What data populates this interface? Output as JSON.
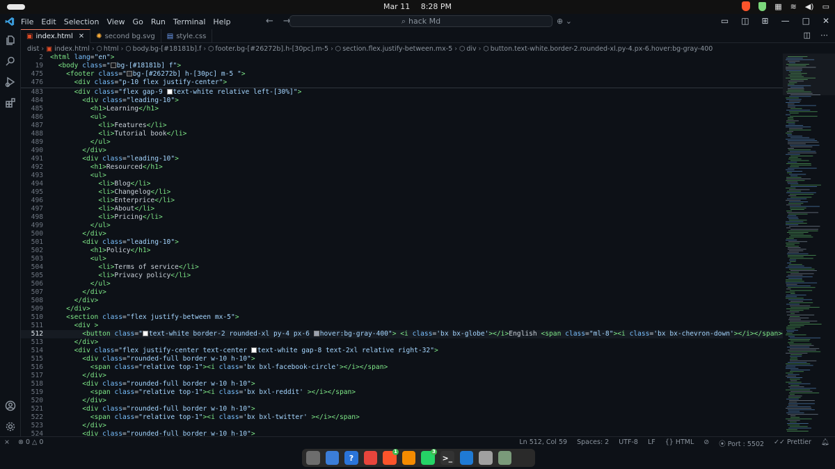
{
  "os": {
    "date": "Mar 11",
    "time": "8:28 PM",
    "volume_icon": "speaker-icon",
    "battery_icon": "battery-icon",
    "network_icon": "wifi-icon"
  },
  "titlebar": {
    "menu": [
      "File",
      "Edit",
      "Selection",
      "View",
      "Go",
      "Run",
      "Terminal",
      "Help"
    ],
    "search_text": "hack Md"
  },
  "tabs": [
    {
      "label": "index.html",
      "icon": "html-file-icon",
      "active": true,
      "color": "#e34c26"
    },
    {
      "label": "second bg.svg",
      "icon": "svg-file-icon",
      "active": false,
      "color": "#ffb13b"
    },
    {
      "label": "style.css",
      "icon": "css-file-icon",
      "active": false,
      "color": "#6e9ef5"
    }
  ],
  "breadcrumb": [
    "dist",
    "index.html",
    "html",
    "body.bg-[#18181b].f",
    "footer.bg-[#26272b].h-[30pc].m-5",
    "section.flex.justify-between.mx-5",
    "div",
    "button.text-white.border-2.rounded-xl.py-4.px-6.hover:bg-gray-400"
  ],
  "editor": {
    "lines": [
      {
        "n": "2",
        "html": "<span class='t-tag'>&lt;html</span> <span class='t-attr'>lang</span>=<span class='t-str'>\"en\"</span><span class='t-tag'>&gt;</span>"
      },
      {
        "n": "19",
        "html": "  <span class='t-tag'>&lt;body</span> <span class='t-attr'>class</span>=<span class='t-str'>\"<span class='sw' style='background:#18181b'></span>bg-[#18181b] f\"</span><span class='t-tag'>&gt;</span>"
      },
      {
        "n": "475",
        "html": "    <span class='t-tag'>&lt;footer</span> <span class='t-attr'>class</span>=<span class='t-str'>\"<span class='sw' style='background:#26272b'></span>bg-[#26272b] h-[30pc] m-5 \"</span><span class='t-tag'>&gt;</span>"
      },
      {
        "n": "476",
        "html": "      <span class='t-tag'>&lt;div</span> <span class='t-attr'>class</span>=<span class='t-str'>\"p-10 flex justify-center\"</span><span class='t-tag'>&gt;</span>"
      },
      {
        "n": "483",
        "html": "      <span class='t-tag'>&lt;div</span> <span class='t-attr'>class</span>=<span class='t-str'>\"flex gap-9 <span class='sw' style='background:#ffffff'></span>text-white relative left-[30%]\"</span><span class='t-tag'>&gt;</span>"
      },
      {
        "n": "484",
        "html": "        <span class='t-tag'>&lt;div</span> <span class='t-attr'>class</span>=<span class='t-str'>\"leading-10\"</span><span class='t-tag'>&gt;</span>"
      },
      {
        "n": "485",
        "html": "          <span class='t-tag'>&lt;h1&gt;</span>Learning<span class='t-tag'>&lt;/h1&gt;</span>"
      },
      {
        "n": "486",
        "html": "          <span class='t-tag'>&lt;ul&gt;</span>"
      },
      {
        "n": "487",
        "html": "            <span class='t-tag'>&lt;li&gt;</span>Features<span class='t-tag'>&lt;/li&gt;</span>"
      },
      {
        "n": "488",
        "html": "            <span class='t-tag'>&lt;li&gt;</span>Tutorial book<span class='t-tag'>&lt;/li&gt;</span>"
      },
      {
        "n": "489",
        "html": "          <span class='t-tag'>&lt;/ul&gt;</span>"
      },
      {
        "n": "490",
        "html": "        <span class='t-tag'>&lt;/div&gt;</span>"
      },
      {
        "n": "491",
        "html": "        <span class='t-tag'>&lt;div</span> <span class='t-attr'>class</span>=<span class='t-str'>\"leading-10\"</span><span class='t-tag'>&gt;</span>"
      },
      {
        "n": "492",
        "html": "          <span class='t-tag'>&lt;h1&gt;</span>Resourced<span class='t-tag'>&lt;/h1&gt;</span>"
      },
      {
        "n": "493",
        "html": "          <span class='t-tag'>&lt;ul&gt;</span>"
      },
      {
        "n": "494",
        "html": "            <span class='t-tag'>&lt;li&gt;</span>Blog<span class='t-tag'>&lt;/li&gt;</span>"
      },
      {
        "n": "495",
        "html": "            <span class='t-tag'>&lt;li&gt;</span>Changelog<span class='t-tag'>&lt;/li&gt;</span>"
      },
      {
        "n": "496",
        "html": "            <span class='t-tag'>&lt;li&gt;</span>Enterprice<span class='t-tag'>&lt;/li&gt;</span>"
      },
      {
        "n": "497",
        "html": "            <span class='t-tag'>&lt;li&gt;</span>About<span class='t-tag'>&lt;/li&gt;</span>"
      },
      {
        "n": "498",
        "html": "            <span class='t-tag'>&lt;li&gt;</span>Pricing<span class='t-tag'>&lt;/li&gt;</span>"
      },
      {
        "n": "499",
        "html": "          <span class='t-tag'>&lt;/ul&gt;</span>"
      },
      {
        "n": "500",
        "html": "        <span class='t-tag'>&lt;/div&gt;</span>"
      },
      {
        "n": "501",
        "html": "        <span class='t-tag'>&lt;div</span> <span class='t-attr'>class</span>=<span class='t-str'>\"leading-10\"</span><span class='t-tag'>&gt;</span>"
      },
      {
        "n": "502",
        "html": "          <span class='t-tag'>&lt;h1&gt;</span>Policy<span class='t-tag'>&lt;/h1&gt;</span>"
      },
      {
        "n": "503",
        "html": "          <span class='t-tag'>&lt;ul&gt;</span>"
      },
      {
        "n": "504",
        "html": "            <span class='t-tag'>&lt;li&gt;</span>Terms of service<span class='t-tag'>&lt;/li&gt;</span>"
      },
      {
        "n": "505",
        "html": "            <span class='t-tag'>&lt;li&gt;</span>Privacy policy<span class='t-tag'>&lt;/li&gt;</span>"
      },
      {
        "n": "506",
        "html": "          <span class='t-tag'>&lt;/ul&gt;</span>"
      },
      {
        "n": "507",
        "html": "        <span class='t-tag'>&lt;/div&gt;</span>"
      },
      {
        "n": "508",
        "html": "      <span class='t-tag'>&lt;/div&gt;</span>"
      },
      {
        "n": "509",
        "html": "    <span class='t-tag'>&lt;/div&gt;</span>"
      },
      {
        "n": "510",
        "html": "    <span class='t-tag'>&lt;section</span> <span class='t-attr'>class</span>=<span class='t-str'>\"flex justify-between mx-5\"</span><span class='t-tag'>&gt;</span>"
      },
      {
        "n": "511",
        "html": "      <span class='t-tag'>&lt;div</span> <span class='t-tag'>&gt;</span>"
      },
      {
        "n": "512",
        "html": "        <span class='t-tag'>&lt;button</span> <span class='t-attr'>class</span>=<span class='t-str'>\"<span class='sw' style='background:#ffffff'></span>text-white border-2 rounded-xl py-4 px-6 <span class='sw' style='background:#9ca3af'></span>hover:bg-gray-400\"</span><span class='t-tag'>&gt;</span> <span class='t-tag'>&lt;i</span> <span class='t-attr'>class</span>=<span class='t-str'>'bx bx-globe'</span><span class='t-tag'>&gt;&lt;/i&gt;</span>English <span class='t-tag'>&lt;span</span> <span class='t-attr'>class</span>=<span class='t-str'>\"ml-8\"</span><span class='t-tag'>&gt;&lt;i</span> <span class='t-attr'>class</span>=<span class='t-str'>'bx bx-chevron-down'</span><span class='t-tag'>&gt;&lt;/i&gt;&lt;/span&gt;&lt;/button&gt;</span>"
      },
      {
        "n": "513",
        "html": "      <span class='t-tag'>&lt;/div&gt;</span>"
      },
      {
        "n": "514",
        "html": "      <span class='t-tag'>&lt;div</span> <span class='t-attr'>class</span>=<span class='t-str'>\"flex justify-center text-center <span class='sw' style='background:#ffffff'></span>text-white gap-8 text-2xl relative right-32\"</span><span class='t-tag'>&gt;</span>"
      },
      {
        "n": "515",
        "html": "        <span class='t-tag'>&lt;div</span> <span class='t-attr'>class</span>=<span class='t-str'>\"rounded-full border w-10 h-10\"</span><span class='t-tag'>&gt;</span>"
      },
      {
        "n": "516",
        "html": "          <span class='t-tag'>&lt;span</span> <span class='t-attr'>class</span>=<span class='t-str'>\"relative top-1\"</span><span class='t-tag'>&gt;&lt;i</span> <span class='t-attr'>class</span>=<span class='t-str'>'bx bxl-facebook-circle'</span><span class='t-tag'>&gt;&lt;/i&gt;&lt;/span&gt;</span>"
      },
      {
        "n": "517",
        "html": "        <span class='t-tag'>&lt;/div&gt;</span>"
      },
      {
        "n": "518",
        "html": "        <span class='t-tag'>&lt;div</span> <span class='t-attr'>class</span>=<span class='t-str'>\"rounded-full border w-10 h-10\"</span><span class='t-tag'>&gt;</span>"
      },
      {
        "n": "519",
        "html": "          <span class='t-tag'>&lt;span</span> <span class='t-attr'>class</span>=<span class='t-str'>\"relative top-1\"</span><span class='t-tag'>&gt;&lt;i</span> <span class='t-attr'>class</span>=<span class='t-str'>'bx bxl-reddit'</span> <span class='t-tag'>&gt;&lt;/i&gt;&lt;/span&gt;</span>"
      },
      {
        "n": "520",
        "html": "        <span class='t-tag'>&lt;/div&gt;</span>"
      },
      {
        "n": "521",
        "html": "        <span class='t-tag'>&lt;div</span> <span class='t-attr'>class</span>=<span class='t-str'>\"rounded-full border w-10 h-10\"</span><span class='t-tag'>&gt;</span>"
      },
      {
        "n": "522",
        "html": "          <span class='t-tag'>&lt;span</span> <span class='t-attr'>class</span>=<span class='t-str'>\"relative top-1\"</span><span class='t-tag'>&gt;&lt;i</span> <span class='t-attr'>class</span>=<span class='t-str'>'bx bxl-twitter'</span> <span class='t-tag'>&gt;&lt;/i&gt;&lt;/span&gt;</span>"
      },
      {
        "n": "523",
        "html": "        <span class='t-tag'>&lt;/div&gt;</span>"
      },
      {
        "n": "524",
        "html": "        <span class='t-tag'>&lt;div</span> <span class='t-attr'>class</span>=<span class='t-str'>\"rounded-full border w-10 h-10\"</span><span class='t-tag'>&gt;</span>"
      }
    ],
    "current_line": "512"
  },
  "statusbar": {
    "errors": "0",
    "warnings": "0",
    "position": "Ln 512, Col 59",
    "spaces": "Spaces: 2",
    "encoding": "UTF-8",
    "eol": "LF",
    "language": "HTML",
    "port": "Port : 5502",
    "formatter": "Prettier"
  },
  "dock": [
    {
      "name": "files-app",
      "color": "#6d6d6d",
      "label": ""
    },
    {
      "name": "store-app",
      "color": "#3b7dd8",
      "label": ""
    },
    {
      "name": "help-app",
      "color": "#2a74d9",
      "label": "?"
    },
    {
      "name": "chrome-app",
      "color": "#e8453c",
      "label": ""
    },
    {
      "name": "brave-app",
      "color": "#fb542b",
      "label": "",
      "badge": "1"
    },
    {
      "name": "vlc-app",
      "color": "#f48b00",
      "label": ""
    },
    {
      "name": "whatsapp-app",
      "color": "#25d366",
      "label": "",
      "badge": "3"
    },
    {
      "name": "terminal-app",
      "color": "#333333",
      "label": ">_"
    },
    {
      "name": "vscode-app",
      "color": "#1f7ad4",
      "label": ""
    },
    {
      "name": "text-editor-app",
      "color": "#a0a0a0",
      "label": ""
    },
    {
      "name": "trash-app",
      "color": "#7a9a7a",
      "label": ""
    },
    {
      "name": "app-grid",
      "color": "#2a2a2a",
      "label": ""
    }
  ]
}
